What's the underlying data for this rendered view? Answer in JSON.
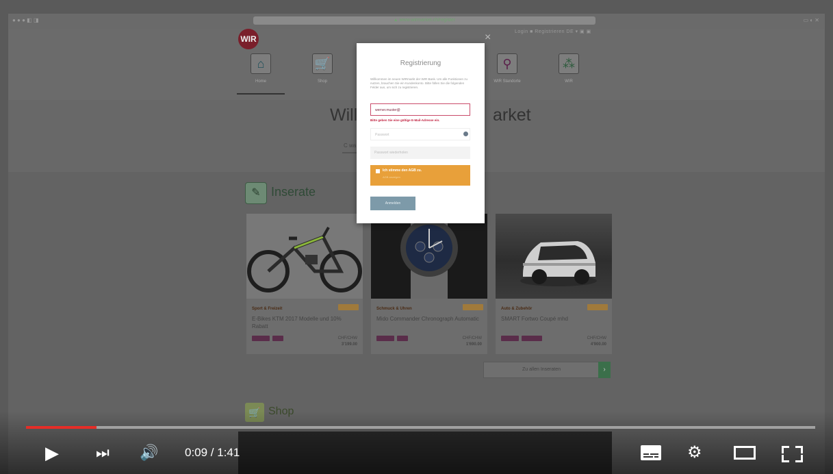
{
  "browser": {
    "url_text": "▲ www.wirmarket.ch/register",
    "left_buttons": "● ● ●  ◧ ◨",
    "right_buttons": "▭ ◐ ✕"
  },
  "site": {
    "logo_text": "WIR",
    "top_links": "Login ■   Registrieren   DE ▾   ▣ ▣",
    "nav": [
      {
        "label": "Home",
        "icon": "home-icon"
      },
      {
        "label": "Shop",
        "icon": "cart-icon"
      },
      {
        "label": "WIR Standorte",
        "icon": "location-icon"
      },
      {
        "label": "WIR",
        "icon": "network-icon"
      }
    ],
    "hero_left": "Willk",
    "hero_right": "arket",
    "hero_sub": "C wa"
  },
  "inserate": {
    "title": "Inserate",
    "cards": [
      {
        "category": "Sport & Freizeit",
        "title": "E-Bikes KTM 2017 Modelle und 10% Rabatt",
        "price_label": "CHF/CHW",
        "price": "3'199.00"
      },
      {
        "category": "Schmuck & Uhren",
        "title": "Mido Commander Chronograph Automatic",
        "price_label": "CHF/CHW",
        "price": "1'690.00"
      },
      {
        "category": "Auto & Zubehör",
        "title": "SMART Fortwo Coupé mhd",
        "price_label": "CHF/CHW",
        "price": "4'900.00"
      }
    ],
    "all_button": "Zu allen Inseraten",
    "all_arrow": "›"
  },
  "shop": {
    "title": "Shop"
  },
  "modal": {
    "close": "×",
    "title": "Registrierung",
    "description": "Willkommen im neuen WIRmarkt der WIR Bank. Um alle Funktionen zu nutzen, brauchen Sie ein Kundenkonto. Bitte füllen Sie die folgenden Felder aus, um sich zu registrieren.",
    "email_value": "werner.muster@",
    "email_error": "Bitte geben Sie eine gültige E-Mail-Adresse ein.",
    "password_placeholder": "Passwort",
    "password_repeat_placeholder": "Passwort wiederholen",
    "agb_label": "Ich stimme den AGB zu.",
    "agb_sub": "AGB anzeigen",
    "submit": "Anmelden"
  },
  "video": {
    "time": "0:09 / 1:41",
    "progress_fraction": 0.0891,
    "accent_color": "#e52d27"
  }
}
